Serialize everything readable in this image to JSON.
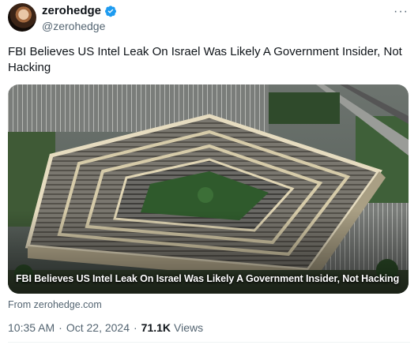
{
  "user": {
    "display_name": "zerohedge",
    "handle": "@zerohedge",
    "verified_color": "#1d9bf0"
  },
  "menu": {
    "more_label": "···"
  },
  "tweet": {
    "text": "FBI Believes US Intel Leak On Israel Was Likely A Government Insider, Not Hacking"
  },
  "card": {
    "caption": "FBI Believes US Intel Leak On Israel Was Likely A Government Insider, Not Hacking",
    "source": "From zerohedge.com",
    "image_subject": "aerial-building-photo"
  },
  "meta": {
    "time": "10:35 AM",
    "separator": "·",
    "date": "Oct 22, 2024",
    "views_count": "71.1K",
    "views_label": "Views"
  }
}
